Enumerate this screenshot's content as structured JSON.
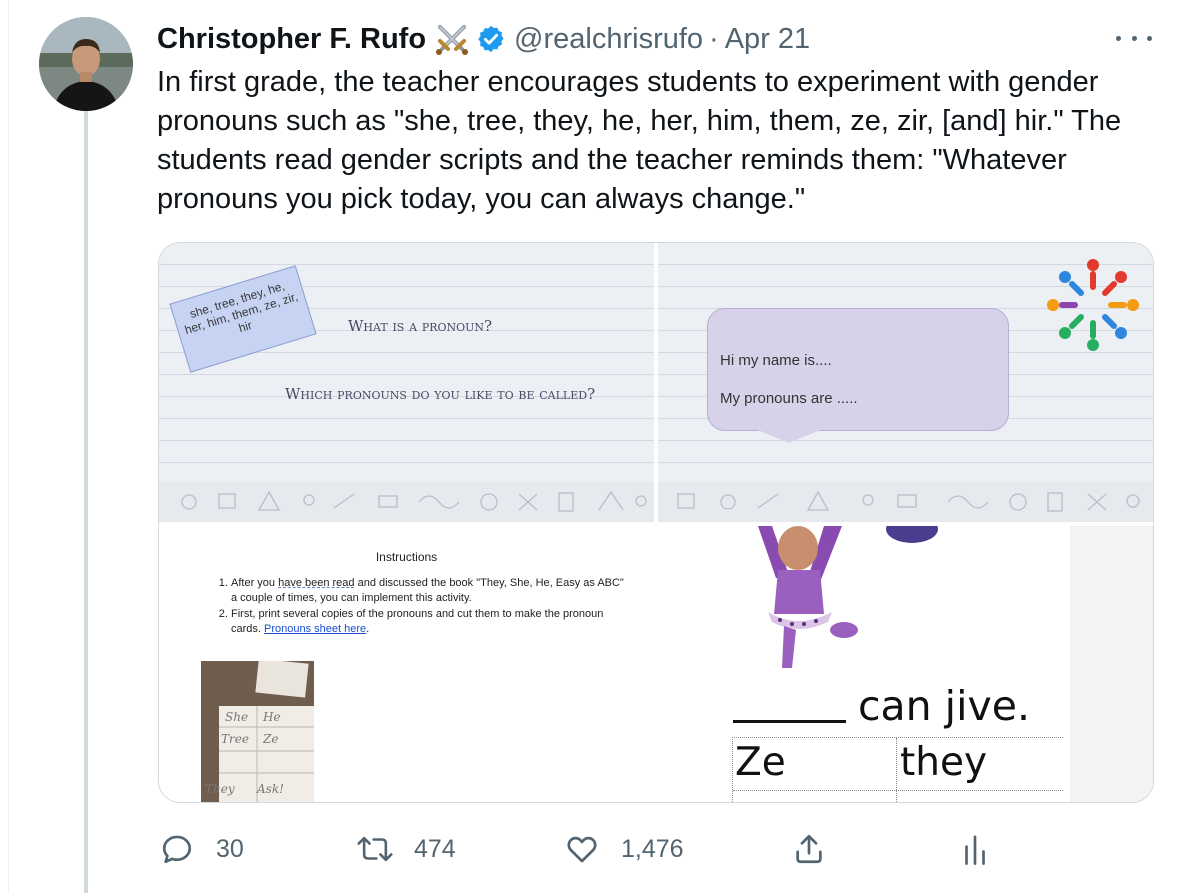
{
  "tweet": {
    "author_name": "Christopher F. Rufo",
    "handle": "@realchrisrufo",
    "separator": "·",
    "date": "Apr 21",
    "text": "In first grade, the teacher encourages students to experiment with gender pronouns such as \"she, tree, they, he, her, him, them, ze, zir, [and] hir.\" The students read gender scripts and the teacher reminds them: \"Whatever pronouns you pick today, you can always change.\""
  },
  "icons": {
    "emoji": "crossed-swords-icon",
    "verified": "verified-badge-icon",
    "more": "more-icon",
    "reply": "reply-icon",
    "retweet": "retweet-icon",
    "like": "like-icon",
    "share": "share-icon",
    "analytics": "analytics-icon"
  },
  "colors": {
    "verified": "#1d9bf0",
    "muted": "#536471",
    "link": "#1a4fd0",
    "thread_line": "#cfd9de"
  },
  "media": {
    "slide1": {
      "card_text": "she, tree, they, he, her, him, them, ze, zir, hir",
      "question1": "What is a pronoun?",
      "question2": "Which pronouns do you like to be called?"
    },
    "slide2": {
      "line1": "Hi my name is....",
      "line2": "My pronouns are ....."
    },
    "doc": {
      "title": "Instructions",
      "item1_before": "After you ",
      "item1_underlined": "have been read",
      "item1_after": " and discussed the book  \"They, She, He, Easy as ABC\" a couple of times,  you can implement this activity.",
      "item2_before": "First, print several copies of the pronouns and cut them to make the pronoun cards. ",
      "item2_link": "Pronouns sheet here",
      "item2_after": ".",
      "photo_words": [
        "She",
        "He",
        "Tree",
        "Ze",
        "They",
        "Ask!"
      ]
    },
    "worksheet": {
      "sentence": "can jive.",
      "cells": [
        "Ze",
        "they"
      ]
    }
  },
  "actions": {
    "reply_count": "30",
    "retweet_count": "474",
    "like_count": "1,476"
  }
}
